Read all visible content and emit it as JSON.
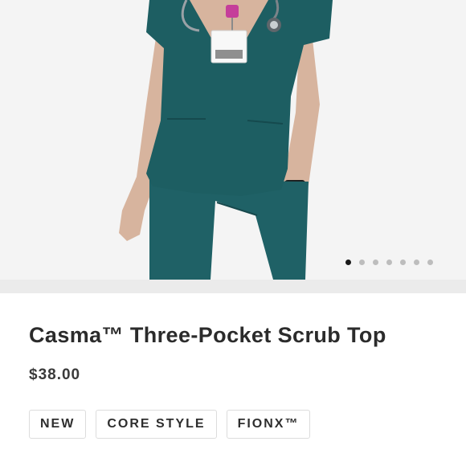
{
  "product": {
    "title": "Casma™ Three-Pocket Scrub Top",
    "price": "$38.00",
    "tags": [
      "NEW",
      "CORE STYLE",
      "FIONX™"
    ]
  },
  "gallery": {
    "image_subject": "model-wearing-teal-scrubs",
    "slide_count": 7,
    "active_slide": 1
  },
  "colors": {
    "scrub_teal": "#1d5e62",
    "background": "#f4f4f4",
    "active_dot": "#1a1a1a",
    "inactive_dot": "#bdbdbd"
  }
}
